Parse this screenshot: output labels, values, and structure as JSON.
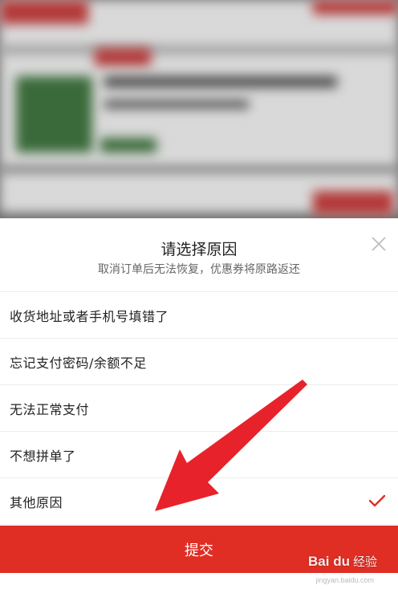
{
  "dialog": {
    "title": "请选择原因",
    "subtitle": "取消订单后无法恢复，优惠券将原路返还"
  },
  "reasons": [
    {
      "label": "收货地址或者手机号填错了",
      "selected": false
    },
    {
      "label": "忘记支付密码/余额不足",
      "selected": false
    },
    {
      "label": "无法正常支付",
      "selected": false
    },
    {
      "label": "不想拼单了",
      "selected": false
    },
    {
      "label": "其他原因",
      "selected": true
    }
  ],
  "submit_label": "提交",
  "colors": {
    "accent": "#e02e24",
    "text": "#222222",
    "subtext": "#666666"
  },
  "watermark": {
    "logo": "Bai du",
    "text": "经验",
    "url": "jingyan.baidu.com"
  },
  "icons": {
    "close": "close-icon",
    "check": "check-icon",
    "arrow": "arrow-annotation"
  }
}
